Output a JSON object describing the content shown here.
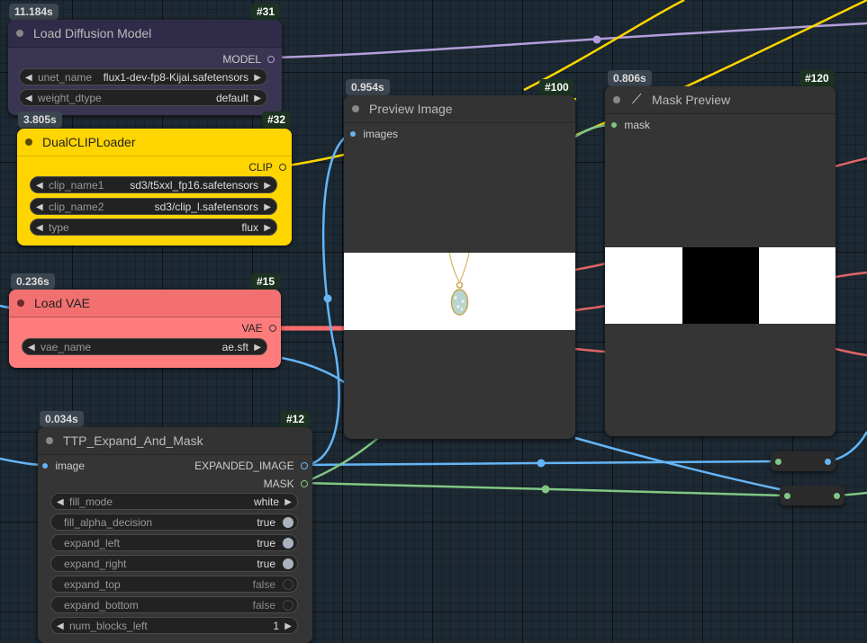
{
  "colors": {
    "model_link": "#b39ddb",
    "clip_link": "#ffd500",
    "vae_link": "#ff6e6e",
    "image_link": "#64b5f6",
    "mask_link": "#81c784",
    "widget_true": "#aab3c0",
    "widget_false": "#222222"
  },
  "nodes": {
    "load_diffusion": {
      "timing": "11.184s",
      "badge": "#31",
      "title": "Load Diffusion Model",
      "output": "MODEL",
      "widgets": [
        {
          "label": "unet_name",
          "value": "flux1-dev-fp8-Kijai.safetensors"
        },
        {
          "label": "weight_dtype",
          "value": "default"
        }
      ]
    },
    "dual_clip": {
      "timing": "3.805s",
      "badge": "#32",
      "title": "DualCLIPLoader",
      "output": "CLIP",
      "widgets": [
        {
          "label": "clip_name1",
          "value": "sd3/t5xxl_fp16.safetensors"
        },
        {
          "label": "clip_name2",
          "value": "sd3/clip_l.safetensors"
        },
        {
          "label": "type",
          "value": "flux"
        }
      ]
    },
    "load_vae": {
      "timing": "0.236s",
      "badge": "#15",
      "title": "Load VAE",
      "output": "VAE",
      "widgets": [
        {
          "label": "vae_name",
          "value": "ae.sft"
        }
      ]
    },
    "preview_image": {
      "timing": "0.954s",
      "badge": "#100",
      "title": "Preview Image",
      "input": "images"
    },
    "mask_preview": {
      "timing": "0.806s",
      "badge": "#120",
      "title": "Mask Preview",
      "input": "mask"
    },
    "ttp_expand": {
      "timing": "0.034s",
      "badge": "#12",
      "title": "TTP_Expand_And_Mask",
      "input": "image",
      "outputs": [
        "EXPANDED_IMAGE",
        "MASK"
      ],
      "combo": {
        "label": "fill_mode",
        "value": "white"
      },
      "toggles": [
        {
          "label": "fill_alpha_decision",
          "value": "true",
          "state": "on"
        },
        {
          "label": "expand_left",
          "value": "true",
          "state": "on"
        },
        {
          "label": "expand_right",
          "value": "true",
          "state": "on"
        },
        {
          "label": "expand_top",
          "value": "false",
          "state": "off"
        },
        {
          "label": "expand_bottom",
          "value": "false",
          "state": "off"
        }
      ],
      "number": {
        "label": "num_blocks_left",
        "value": "1"
      }
    }
  }
}
